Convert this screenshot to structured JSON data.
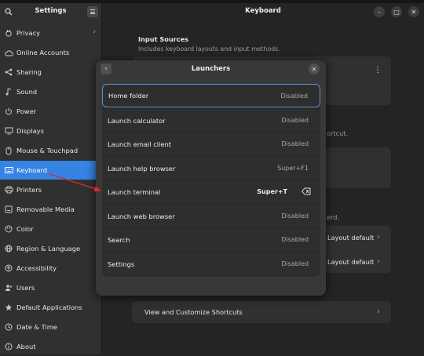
{
  "sidebar": {
    "title": "Settings",
    "items": [
      {
        "label": "Privacy",
        "icon": "hand-icon",
        "chevron": "›"
      },
      {
        "label": "Online Accounts",
        "icon": "cloud-icon"
      },
      {
        "label": "Sharing",
        "icon": "share-icon"
      },
      {
        "label": "Sound",
        "icon": "music-note-icon"
      },
      {
        "label": "Power",
        "icon": "power-icon"
      },
      {
        "label": "Displays",
        "icon": "display-icon"
      },
      {
        "label": "Mouse & Touchpad",
        "icon": "mouse-icon"
      },
      {
        "label": "Keyboard",
        "icon": "keyboard-icon"
      },
      {
        "label": "Printers",
        "icon": "printer-icon"
      },
      {
        "label": "Removable Media",
        "icon": "media-icon"
      },
      {
        "label": "Color",
        "icon": "palette-icon"
      },
      {
        "label": "Region & Language",
        "icon": "globe-icon"
      },
      {
        "label": "Accessibility",
        "icon": "accessibility-icon"
      },
      {
        "label": "Users",
        "icon": "users-icon"
      },
      {
        "label": "Default Applications",
        "icon": "star-icon"
      },
      {
        "label": "Date & Time",
        "icon": "clock-icon"
      },
      {
        "label": "About",
        "icon": "info-icon"
      }
    ],
    "active_index": 7
  },
  "main": {
    "title": "Keyboard",
    "input_sources_title": "Input Sources",
    "input_sources_subtitle": "Includes keyboard layouts and input methods.",
    "kebab": "⋮",
    "frag_shortcut": "ortcut.",
    "frag_board": "erd.",
    "layout_default_1": "Layout default",
    "layout_default_2": "Layout default",
    "view_shortcuts": "View and Customize Shortcuts"
  },
  "window_controls": {
    "minimize": "–",
    "maximize": "□",
    "close": "✕"
  },
  "dialog": {
    "title": "Launchers",
    "back": "‹",
    "close": "✕",
    "rows": [
      {
        "name": "Home folder",
        "value": "Disabled"
      },
      {
        "name": "Launch calculator",
        "value": "Disabled"
      },
      {
        "name": "Launch email client",
        "value": "Disabled"
      },
      {
        "name": "Launch help browser",
        "value": "Super+F1"
      },
      {
        "name": "Launch terminal",
        "value": "Super+T"
      },
      {
        "name": "Launch web browser",
        "value": "Disabled"
      },
      {
        "name": "Search",
        "value": "Disabled"
      },
      {
        "name": "Settings",
        "value": "Disabled"
      }
    ]
  },
  "colors": {
    "accent": "#3584e4",
    "arrow": "#e0262b",
    "background": "#242424",
    "sidebar": "#303030"
  }
}
